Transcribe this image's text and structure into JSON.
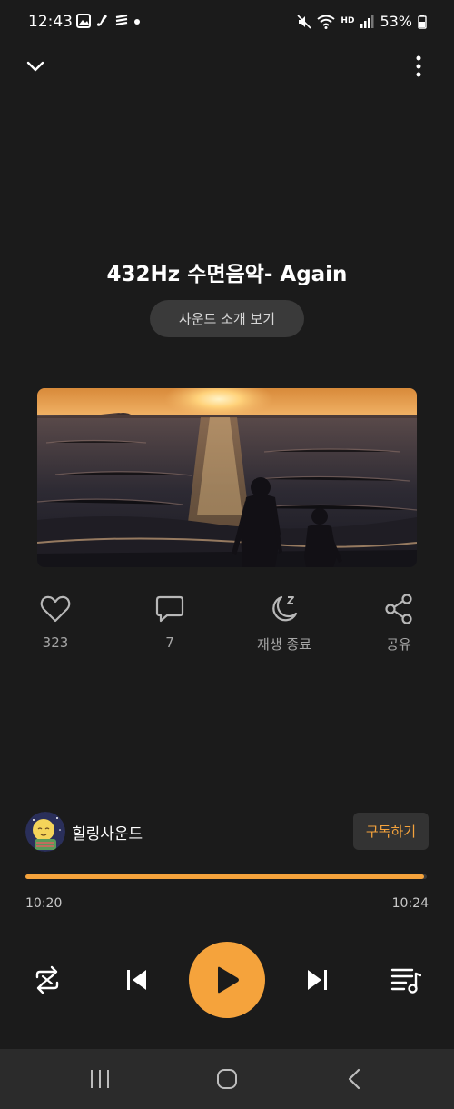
{
  "status_bar": {
    "time": "12:43",
    "battery_percent": "53%",
    "network_label": "HD"
  },
  "sound": {
    "title": "432Hz 수면음악- Again",
    "intro_button": "사운드 소개 보기"
  },
  "actions": {
    "like_count": "323",
    "comment_count": "7",
    "sleep_timer_label": "재생 종료",
    "share_label": "공유"
  },
  "channel": {
    "name": "힐링사운드",
    "subscribe_label": "구독하기"
  },
  "playback": {
    "current_time": "10:20",
    "total_time": "10:24",
    "progress": 0.994
  },
  "icons": {
    "collapse": "chevron-down-icon",
    "more": "more-vertical-icon",
    "like": "heart-icon",
    "comment": "comment-icon",
    "sleep": "moon-sleep-icon",
    "share": "share-icon",
    "repeat": "repeat-icon",
    "previous": "skip-previous-icon",
    "play": "play-icon",
    "next": "skip-next-icon",
    "playlist": "playlist-icon"
  },
  "colors": {
    "accent": "#f5a33c",
    "background": "#1b1b1b"
  }
}
